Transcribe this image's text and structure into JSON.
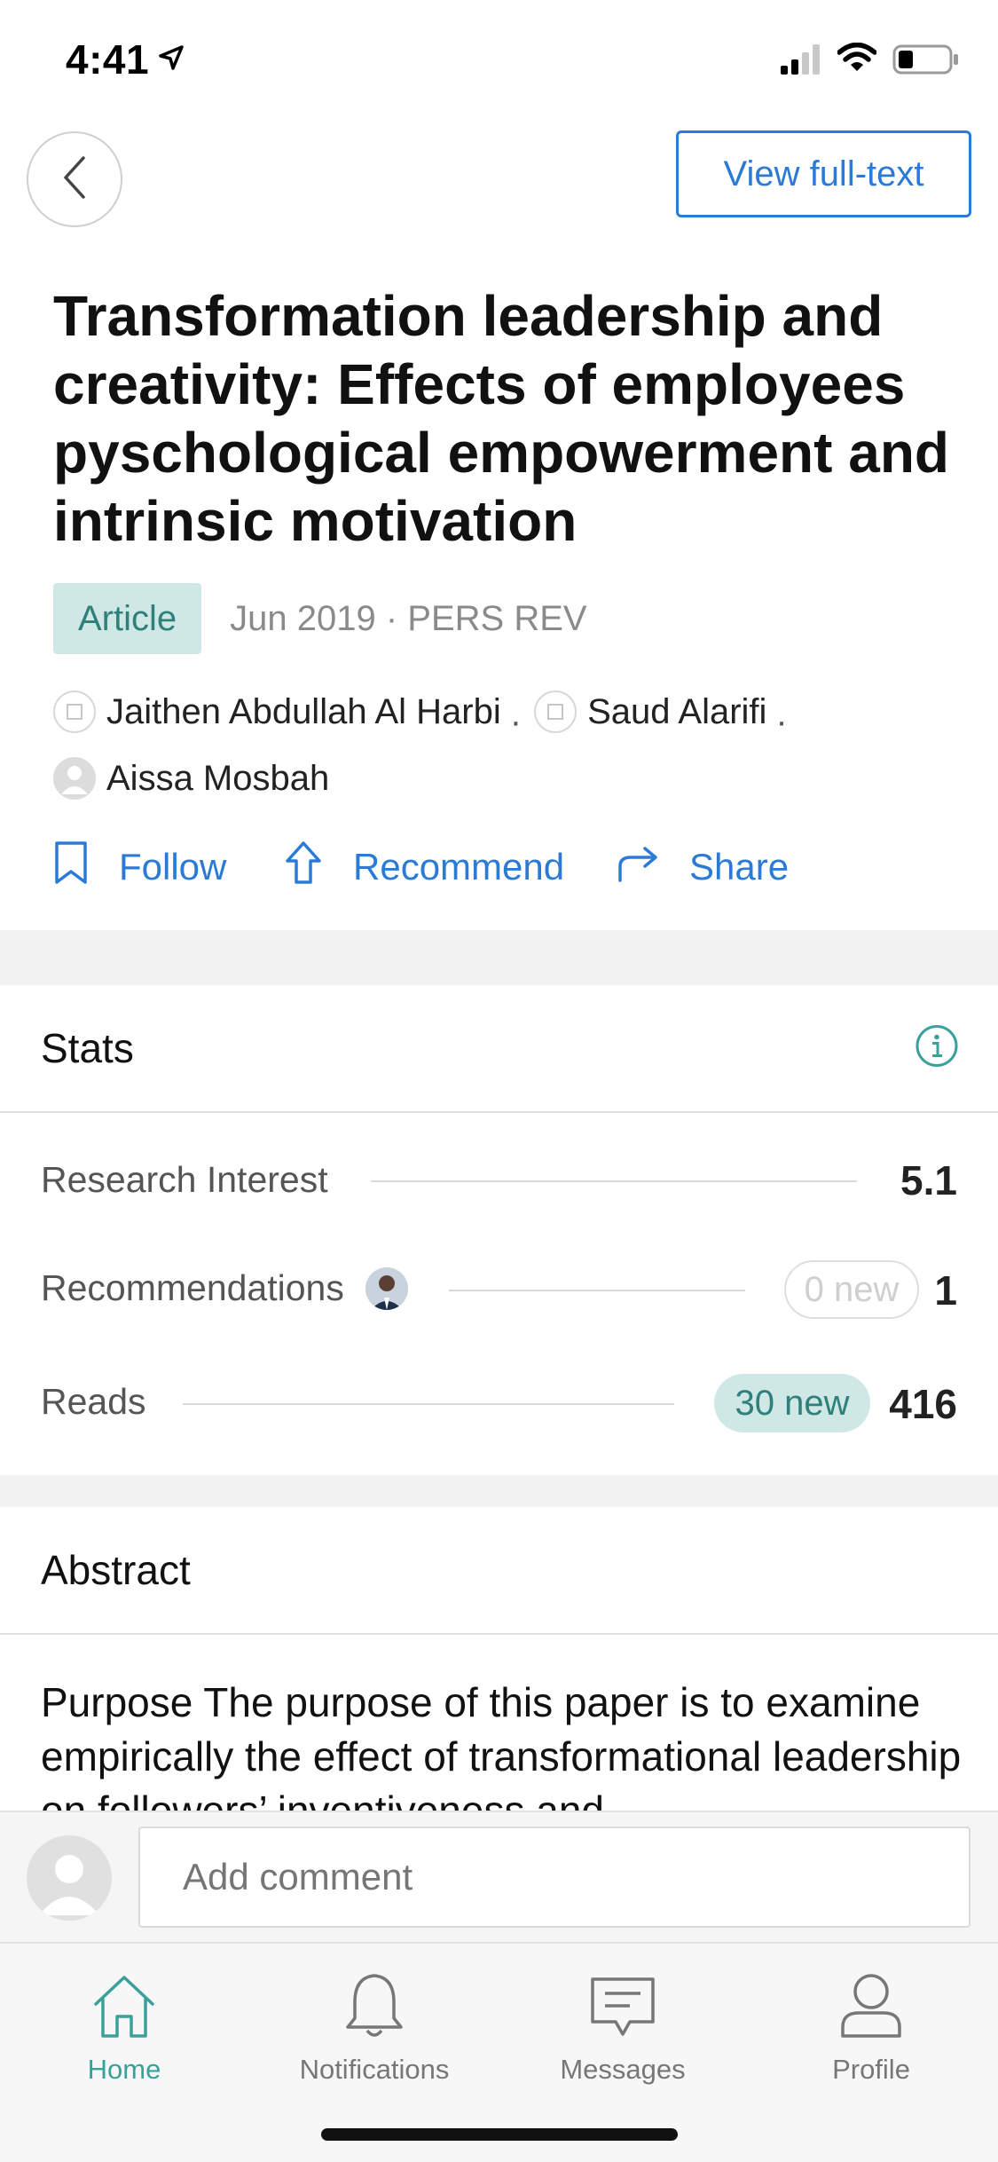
{
  "status_bar": {
    "time": "4:41"
  },
  "nav": {
    "full_text_label": "View full-text"
  },
  "article": {
    "title": "Transformation leadership and creativity: Effects of employees pyschological empowerment and intrinsic motivation",
    "type": "Article",
    "meta": "Jun 2019 · PERS REV",
    "authors": [
      {
        "name": "Jaithen Abdullah Al Harbi",
        "avatar": "institution-icon"
      },
      {
        "name": "Saud Alarifi",
        "avatar": "institution-icon"
      },
      {
        "name": "Aissa Mosbah",
        "avatar": "person-placeholder-icon"
      }
    ],
    "separator": "·"
  },
  "actions": {
    "follow": "Follow",
    "recommend": "Recommend",
    "share": "Share"
  },
  "stats": {
    "title": "Stats",
    "research_interest": {
      "label": "Research Interest",
      "value": "5.1"
    },
    "recommendations": {
      "label": "Recommendations",
      "new": "0 new",
      "value": "1"
    },
    "reads": {
      "label": "Reads",
      "new": "30 new",
      "value": "416"
    }
  },
  "abstract": {
    "title": "Abstract",
    "text": "Purpose The purpose of this paper is to examine empirically the effect of transformational leadership on followers’ inventiveness and"
  },
  "comment": {
    "placeholder": "Add comment"
  },
  "tabs": [
    {
      "label": "Home",
      "icon": "home-icon",
      "active": true
    },
    {
      "label": "Notifications",
      "icon": "bell-icon",
      "active": false
    },
    {
      "label": "Messages",
      "icon": "message-icon",
      "active": false
    },
    {
      "label": "Profile",
      "icon": "profile-icon",
      "active": false
    }
  ],
  "colors": {
    "accent_blue": "#2b7bd6",
    "accent_teal": "#3aa09a",
    "badge_bg": "#cfe8e6"
  }
}
